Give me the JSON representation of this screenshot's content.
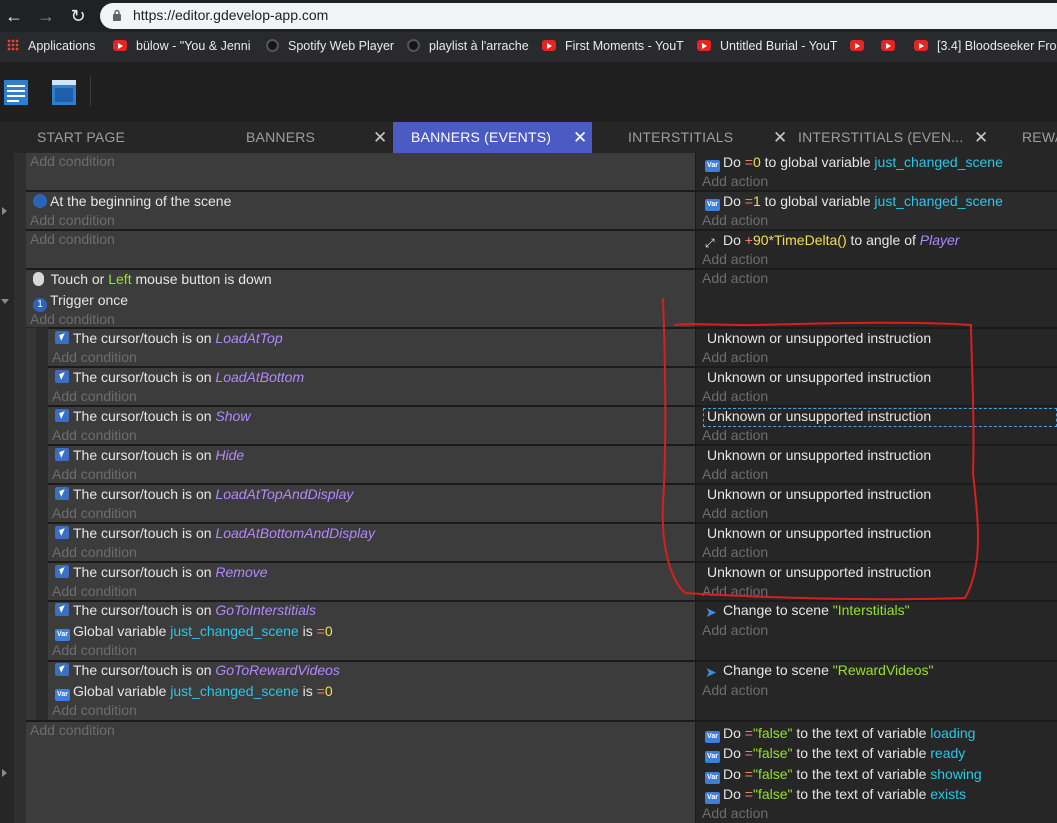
{
  "browser": {
    "url": "https://editor.gdevelop-app.com",
    "bookmarks": [
      {
        "label": "Applications",
        "icon": "apps-grid-icon"
      },
      {
        "label": "bülow - \"You & Jenni",
        "icon": "youtube-icon"
      },
      {
        "label": "Spotify Web Player",
        "icon": "spotify-icon"
      },
      {
        "label": "playlist à l'arrache",
        "icon": "spotify-icon"
      },
      {
        "label": "First Moments - YouT",
        "icon": "youtube-icon"
      },
      {
        "label": "Untitled Burial - YouT",
        "icon": "youtube-icon"
      },
      {
        "label": "",
        "icon": "youtube-icon"
      },
      {
        "label": "",
        "icon": "youtube-icon"
      },
      {
        "label": "[3.4] Bloodseeker Fro",
        "icon": "youtube-icon"
      }
    ]
  },
  "tabs": [
    {
      "label": "START PAGE",
      "closable": false,
      "active": false
    },
    {
      "label": "BANNERS",
      "closable": true,
      "active": false
    },
    {
      "label": "BANNERS (EVENTS)",
      "closable": true,
      "active": true
    },
    {
      "label": "INTERSTITIALS",
      "closable": true,
      "active": false
    },
    {
      "label": "INTERSTITIALS (EVEN...",
      "closable": true,
      "active": false
    },
    {
      "label": "REWA",
      "closable": false,
      "active": false
    }
  ],
  "labels": {
    "add_condition": "Add condition",
    "add_action": "Add action",
    "unknown": "Unknown or unsupported instruction",
    "cursor_on": "The cursor/touch is on",
    "do": "Do",
    "to_global_variable": "to global variable",
    "to_text_of_variable": "to the text of variable",
    "to_angle_of": "to angle of",
    "change_to_scene": "Change to scene",
    "global_variable": "Global variable",
    "is": "is",
    "at_beginning": "At the beginning of the scene",
    "touch_or": "Touch or",
    "left": "Left",
    "mouse_button_down": "mouse button is down",
    "trigger_once": "Trigger once"
  },
  "events": {
    "e1": {
      "op": "=",
      "value": "0",
      "variable": "just_changed_scene"
    },
    "e2": {
      "op": "=",
      "value": "1",
      "variable": "just_changed_scene"
    },
    "e3": {
      "op": "+",
      "expr": "90*TimeDelta()",
      "object": "Player"
    },
    "subevents": [
      "LoadAtTop",
      "LoadAtBottom",
      "Show",
      "Hide",
      "LoadAtTopAndDisplay",
      "LoadAtBottomAndDisplay",
      "Remove"
    ],
    "scene1": {
      "object": "GoToInterstitials",
      "variable": "just_changed_scene",
      "op": "=",
      "value": "0",
      "scene": "\"Interstitials\""
    },
    "scene2": {
      "object": "GoToRewardVideos",
      "variable": "just_changed_scene",
      "op": "=",
      "value": "0",
      "scene": "\"RewardVideos\""
    },
    "last": [
      {
        "op": "=",
        "value": "\"false\"",
        "variable": "loading"
      },
      {
        "op": "=",
        "value": "\"false\"",
        "variable": "ready"
      },
      {
        "op": "=",
        "value": "\"false\"",
        "variable": "showing"
      },
      {
        "op": "=",
        "value": "\"false\"",
        "variable": "exists"
      }
    ]
  },
  "colors": {
    "active_tab": "#4a5bc4",
    "annotation_red": "#d81f1f",
    "variable": "#29c8e8",
    "object": "#b388ff",
    "number": "#f0e050",
    "string": "#96e02e"
  }
}
